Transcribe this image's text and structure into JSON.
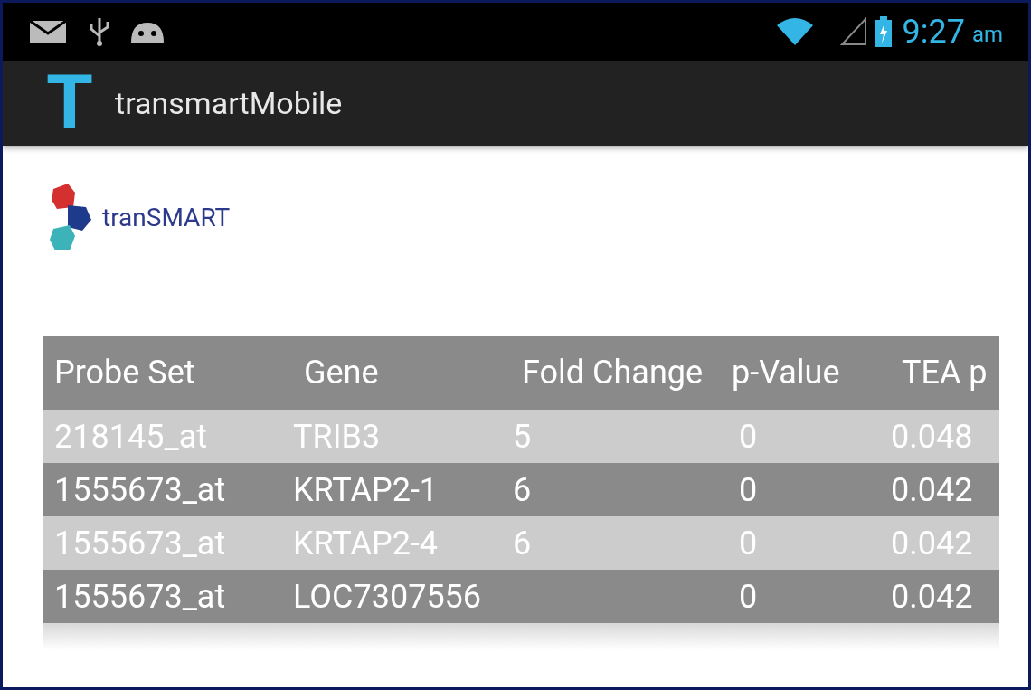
{
  "status_bar": {
    "time": "9:27",
    "ampm": "am"
  },
  "action_bar": {
    "logo_letter": "T",
    "title": "transmartMobile"
  },
  "brand": {
    "name": "tranSMART"
  },
  "table": {
    "columns": [
      "Probe Set",
      "Gene",
      "Fold Change",
      "p-Value",
      "TEA p"
    ],
    "rows": [
      {
        "cells": [
          "218145_at",
          "TRIB3",
          "5",
          "0",
          "0.048"
        ]
      },
      {
        "cells": [
          "1555673_at",
          "KRTAP2-1",
          "6",
          "0",
          "0.042"
        ]
      },
      {
        "cells": [
          "1555673_at",
          "KRTAP2-4",
          "6",
          "0",
          "0.042"
        ]
      },
      {
        "cells": [
          "1555673_at",
          "LOC7307556",
          "",
          "0",
          "0.042"
        ]
      }
    ]
  }
}
